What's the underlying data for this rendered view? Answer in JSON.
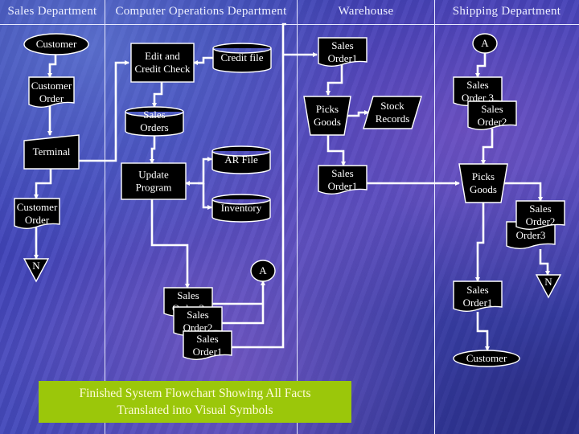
{
  "lanes": [
    {
      "id": "sales",
      "title": "Sales Department"
    },
    {
      "id": "computer",
      "title": "Computer Operations Department"
    },
    {
      "id": "warehouse",
      "title": "Warehouse"
    },
    {
      "id": "shipping",
      "title": "Shipping Department"
    }
  ],
  "nodes": {
    "customer_start": {
      "type": "terminator",
      "lines": [
        "Customer"
      ]
    },
    "customer_order_1": {
      "type": "document",
      "lines": [
        "Customer",
        "Order"
      ]
    },
    "terminal": {
      "type": "manual-input",
      "lines": [
        "Terminal"
      ]
    },
    "customer_order_2": {
      "type": "document",
      "lines": [
        "Customer",
        "Order"
      ]
    },
    "offpage_n_left": {
      "type": "offpage-connector",
      "lines": [
        "N"
      ]
    },
    "edit_credit_check": {
      "type": "process",
      "lines": [
        "Edit and",
        "Credit Check"
      ]
    },
    "credit_file": {
      "type": "disk-storage",
      "lines": [
        "Credit file"
      ]
    },
    "sales_orders_db": {
      "type": "disk-storage",
      "lines": [
        "Sales",
        "Orders"
      ]
    },
    "update_program": {
      "type": "process",
      "lines": [
        "Update",
        "Program"
      ]
    },
    "ar_file": {
      "type": "disk-storage",
      "lines": [
        "AR File"
      ]
    },
    "inventory": {
      "type": "disk-storage",
      "lines": [
        "Inventory"
      ]
    },
    "connector_a_left": {
      "type": "connector",
      "lines": [
        "A"
      ]
    },
    "stack_sales_order3": {
      "type": "document",
      "lines": [
        "Sales",
        "Order 3"
      ]
    },
    "stack_sales_order2": {
      "type": "document",
      "lines": [
        "Sales",
        "Order2"
      ]
    },
    "stack_sales_order1": {
      "type": "document",
      "lines": [
        "Sales",
        "Order1"
      ]
    },
    "wh_sales_order1_top": {
      "type": "document",
      "lines": [
        "Sales",
        "Order1"
      ]
    },
    "wh_picks_goods": {
      "type": "manual-operation",
      "lines": [
        "Picks",
        "Goods"
      ]
    },
    "stock_records": {
      "type": "data",
      "lines": [
        "Stock",
        "Records"
      ]
    },
    "wh_sales_order1_mid": {
      "type": "document",
      "lines": [
        "Sales",
        "Order1"
      ]
    },
    "connector_a_right": {
      "type": "connector",
      "lines": [
        "A"
      ]
    },
    "sh_sales_order3": {
      "type": "document",
      "lines": [
        "Sales",
        "Order 3"
      ]
    },
    "sh_sales_order2": {
      "type": "document",
      "lines": [
        "Sales",
        "Order2"
      ]
    },
    "sh_picks_goods": {
      "type": "manual-operation",
      "lines": [
        "Picks",
        "Goods"
      ]
    },
    "sh_order3": {
      "type": "document",
      "lines": [
        "Order3"
      ]
    },
    "sh_sales_order2b": {
      "type": "document",
      "lines": [
        "Sales",
        "Order2"
      ]
    },
    "offpage_n_right": {
      "type": "offpage-connector",
      "lines": [
        "N"
      ]
    },
    "sh_sales_order1": {
      "type": "document",
      "lines": [
        "Sales",
        "Order1"
      ]
    },
    "customer_end": {
      "type": "terminator",
      "lines": [
        "Customer"
      ]
    }
  },
  "caption": {
    "line1": "Finished System Flowchart Showing All Facts",
    "line2": "Translated into Visual Symbols"
  },
  "colors": {
    "caption_bg": "#9bc70a",
    "caption_text": "#fffbd8",
    "shape_fill": "#000000",
    "line": "#ffffff"
  }
}
